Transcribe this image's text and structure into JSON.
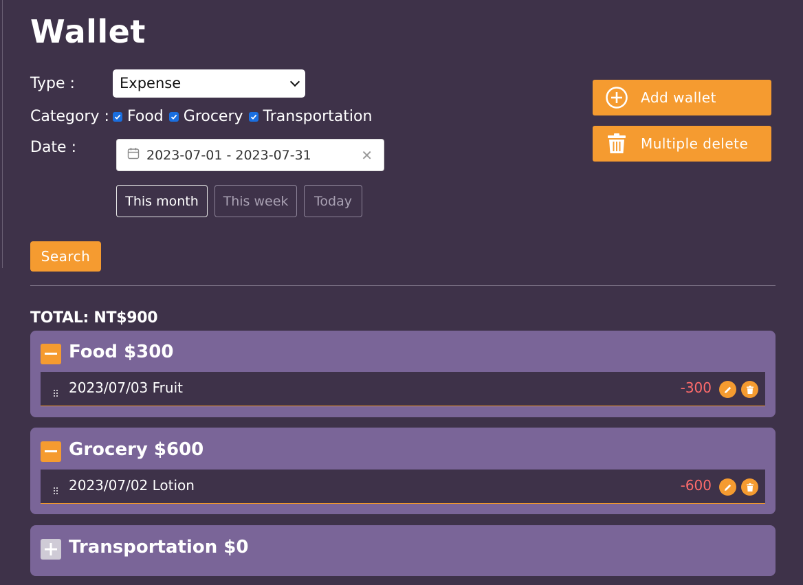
{
  "title": "Wallet",
  "filters": {
    "type_label": "Type :",
    "type_value": "Expense",
    "category_label": "Category :",
    "categories": [
      {
        "label": "Food",
        "checked": true
      },
      {
        "label": "Grocery",
        "checked": true
      },
      {
        "label": "Transportation",
        "checked": true
      }
    ],
    "date_label": "Date :",
    "date_range": "2023-07-01 - 2023-07-31",
    "quick_ranges": [
      "This month",
      "This week",
      "Today"
    ],
    "active_range": "This month",
    "search_label": "Search"
  },
  "actions": {
    "add_wallet": "Add wallet",
    "multiple_delete": "Multiple delete"
  },
  "summary": {
    "total": "TOTAL: NT$900"
  },
  "groups": [
    {
      "title": "Food $300",
      "expanded": true,
      "items": [
        {
          "label": "2023/07/03 Fruit",
          "amount": "-300"
        }
      ]
    },
    {
      "title": "Grocery $600",
      "expanded": true,
      "items": [
        {
          "label": "2023/07/02 Lotion",
          "amount": "-600"
        }
      ]
    },
    {
      "title": "Transportation $0",
      "expanded": false,
      "items": []
    }
  ],
  "colors": {
    "background": "#3e3249",
    "accent": "#f59b30",
    "group_background": "#7a6598",
    "negative_amount": "#ff6b6b"
  },
  "icons": [
    "calendar-icon",
    "clear-icon",
    "plus-circle-icon",
    "trash-icon",
    "minus-icon",
    "plus-icon",
    "drag-handle-icon",
    "edit-icon",
    "delete-icon"
  ]
}
